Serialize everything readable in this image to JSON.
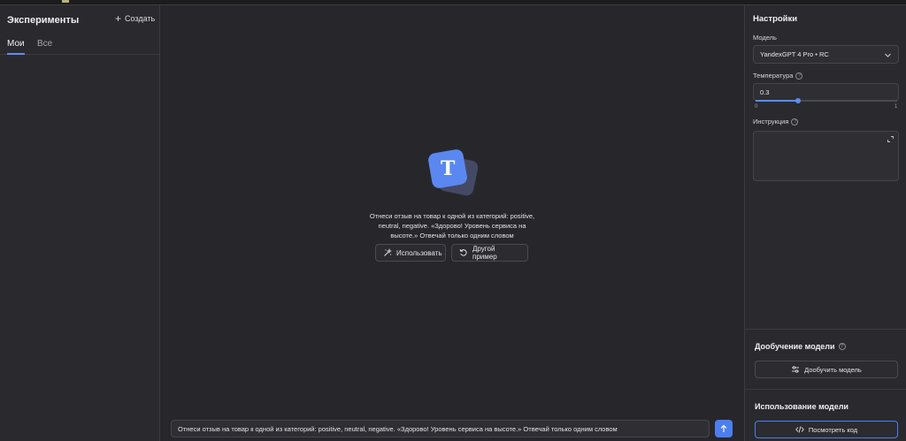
{
  "left_panel": {
    "title": "Эксперименты",
    "create_label": "Создать",
    "tabs": [
      {
        "label": "Мои",
        "active": true
      },
      {
        "label": "Все",
        "active": false
      }
    ]
  },
  "center": {
    "logo_letter": "T",
    "prompt_text": "Отнеси отзыв на товар к одной из категорий: positive, neutral, negative. «Здорово! Уровень сервиса на высоте.» Отвечай только одним словом",
    "use_button": "Использовать",
    "another_button": "Другой пример",
    "input_value": "Отнеси отзыв на товар к одной из категорий: positive, neutral, negative. «Здорово! Уровень сервиса на высоте.» Отвечай только одним словом"
  },
  "settings": {
    "title": "Настройки",
    "model_label": "Модель",
    "model_value": "YandexGPT 4 Pro • RC",
    "temperature_label": "Температура",
    "temperature_value": "0.3",
    "temperature_fraction": 0.3,
    "slider_min": "0",
    "slider_max": "1",
    "instruction_label": "Инструкция"
  },
  "finetune": {
    "title": "Дообучение модели",
    "button": "Дообучить модель"
  },
  "usage": {
    "title": "Использование модели",
    "button": "Посмотреть код"
  },
  "colors": {
    "accent": "#5b8cff",
    "background": "#27272b",
    "panel": "#2a2a2e"
  }
}
